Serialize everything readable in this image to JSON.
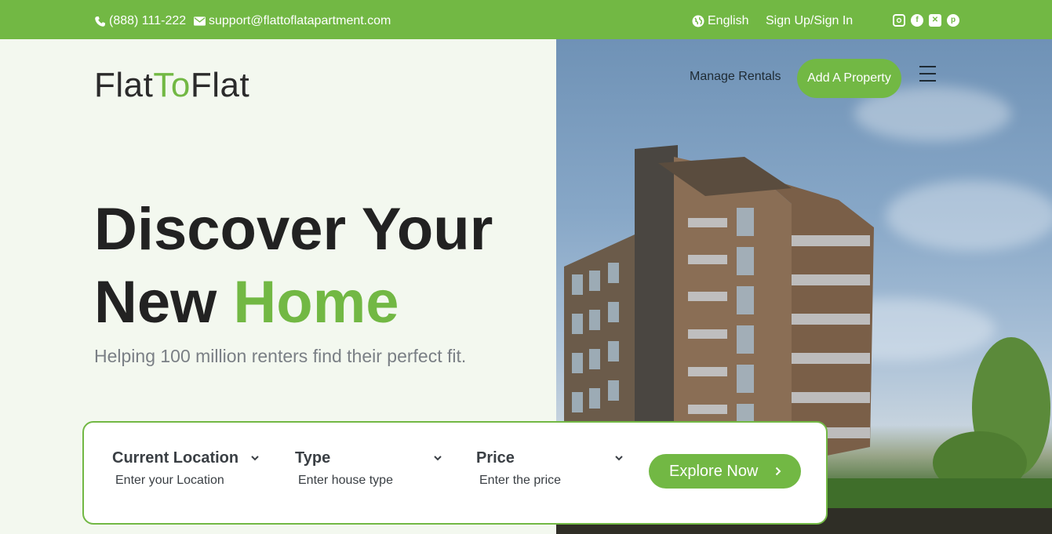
{
  "topbar": {
    "phone": "(888) 111-222",
    "email": "support@flattoflatapartment.com",
    "language": "English",
    "auth": "Sign Up/Sign In",
    "social": [
      "instagram-icon",
      "facebook-icon",
      "x-icon",
      "pinterest-icon"
    ]
  },
  "logo": {
    "part1": "Flat",
    "part2": "To",
    "part3": "Flat"
  },
  "nav": {
    "manage_rentals": "Manage Rentals",
    "add_property": "Add A Property"
  },
  "hero": {
    "line1": "Discover Your",
    "line2_prefix": "New ",
    "line2_highlight": "Home",
    "subtitle": "Helping 100 million renters find their perfect fit."
  },
  "search": {
    "location_label": "Current Location",
    "location_placeholder": "Enter your Location",
    "type_label": "Type",
    "type_placeholder": "Enter house type",
    "price_label": "Price",
    "price_placeholder": "Enter the price",
    "explore_label": "Explore Now"
  },
  "colors": {
    "accent": "#72b844",
    "hero_bg": "#f3f8ef",
    "text_dark": "#222222"
  }
}
